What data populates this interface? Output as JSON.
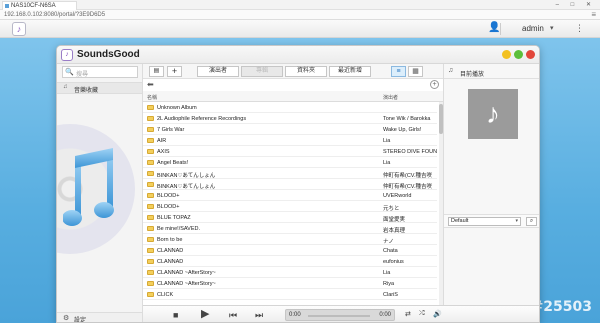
{
  "browser": {
    "tab_title": "NAS10CF-N6SA",
    "url": "192.168.0.102:8080/portal/?3E9D6D5",
    "window_controls": "–  □  ✕"
  },
  "qts": {
    "user_icon": "user-icon",
    "username": "admin",
    "dropdown": "▾",
    "more": "⋮"
  },
  "app": {
    "title": "SoundsGood",
    "search_placeholder": "搜尋",
    "sidebar_item": "音樂收藏",
    "settings_label": "設定"
  },
  "toolbar": {
    "tabs": [
      "演出者",
      "專輯",
      "資料夾",
      "最近新增"
    ],
    "active_tab": 1
  },
  "list": {
    "col_name": "名稱",
    "col_artist": "演出者",
    "rows": [
      {
        "name": "Unknown Album",
        "artist": ""
      },
      {
        "name": "2L Audiophile Reference Recordings",
        "artist": "Tone Wik / Barokka"
      },
      {
        "name": "7 Girls War",
        "artist": "Wake Up, Girls!"
      },
      {
        "name": "AIR",
        "artist": "Lia"
      },
      {
        "name": "AXIS",
        "artist": "STEREO DIVE FOUN"
      },
      {
        "name": "Angel Beats!",
        "artist": "Lia"
      },
      {
        "name": "BINKAN♡あてんしょん",
        "artist": "仲町有希(CV.種吉咲"
      },
      {
        "name": "BINKAN♡あてんしょん",
        "artist": "仲町有希(CV.種吉咲"
      },
      {
        "name": "BLOOD+",
        "artist": "UVERworld"
      },
      {
        "name": "BLOOD+",
        "artist": "元ちと"
      },
      {
        "name": "BLUE TOPAZ",
        "artist": "面堂愛実"
      },
      {
        "name": "Be mine!/SAVED.",
        "artist": "岩本真理"
      },
      {
        "name": "Born to be",
        "artist": "ナノ"
      },
      {
        "name": "CLANNAD",
        "artist": "Chata"
      },
      {
        "name": "CLANNAD",
        "artist": "eufonius"
      },
      {
        "name": "CLANNAD ~AfterStory~",
        "artist": "Lia"
      },
      {
        "name": "CLANNAD ~AfterStory~",
        "artist": "Riya"
      },
      {
        "name": "CLICK",
        "artist": "ClariS"
      }
    ]
  },
  "right_panel": {
    "now_playing_label": "目前播放",
    "playlist_select": "Default",
    "dropdown_arrow": "▾"
  },
  "player": {
    "time_current": "0:00",
    "time_total": "0:00"
  },
  "watermark": "#25503"
}
